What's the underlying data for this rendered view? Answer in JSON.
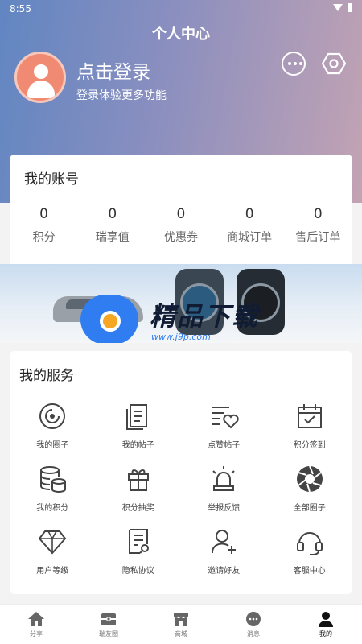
{
  "status_bar": {
    "time": "8:55"
  },
  "header": {
    "title": "个人中心",
    "login_title": "点击登录",
    "login_subtitle": "登录体验更多功能"
  },
  "account": {
    "title": "我的账号",
    "stats": [
      {
        "value": "0",
        "label": "积分"
      },
      {
        "value": "0",
        "label": "瑞享值"
      },
      {
        "value": "0",
        "label": "优惠券"
      },
      {
        "value": "0",
        "label": "商城订单"
      },
      {
        "value": "0",
        "label": "售后订单"
      }
    ]
  },
  "banner": {
    "brand": "精品下载",
    "site": "www.j9p.com"
  },
  "services": {
    "title": "我的服务",
    "items": [
      {
        "label": "我的圈子",
        "icon": "circle-icon"
      },
      {
        "label": "我的帖子",
        "icon": "posts-icon"
      },
      {
        "label": "点赞帖子",
        "icon": "liked-posts-icon"
      },
      {
        "label": "积分签到",
        "icon": "calendar-check-icon"
      },
      {
        "label": "我的积分",
        "icon": "coins-icon"
      },
      {
        "label": "积分抽奖",
        "icon": "gift-icon"
      },
      {
        "label": "举报反馈",
        "icon": "alarm-icon"
      },
      {
        "label": "全部圈子",
        "icon": "aperture-icon"
      },
      {
        "label": "用户等级",
        "icon": "diamond-icon"
      },
      {
        "label": "隐私协议",
        "icon": "document-icon"
      },
      {
        "label": "邀请好友",
        "icon": "add-user-icon"
      },
      {
        "label": "客服中心",
        "icon": "headset-icon"
      }
    ]
  },
  "tabbar": {
    "items": [
      {
        "label": "分享",
        "icon": "home-icon"
      },
      {
        "label": "瑞友圈",
        "icon": "box-icon"
      },
      {
        "label": "商城",
        "icon": "shop-icon"
      },
      {
        "label": "消息",
        "icon": "chat-icon"
      },
      {
        "label": "我的",
        "icon": "person-icon",
        "active": true
      }
    ]
  },
  "colors": {
    "header_start": "#6186c2",
    "header_end": "#c3a3b3",
    "avatar": "#f08a73"
  }
}
